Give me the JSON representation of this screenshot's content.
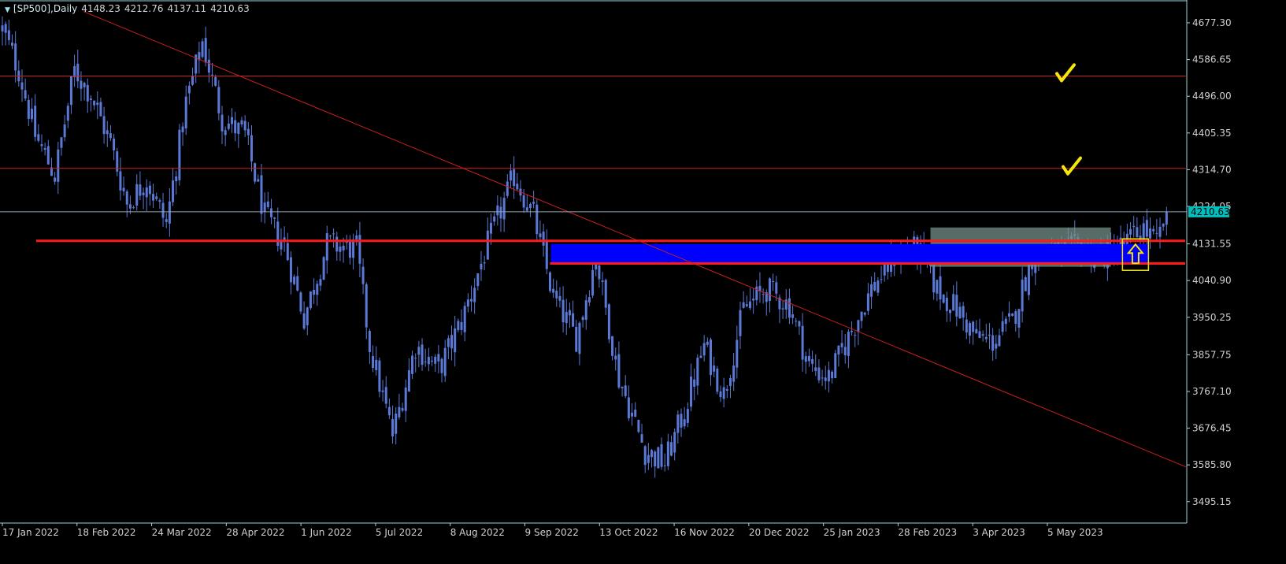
{
  "header": {
    "symbol": "[SP500],Daily",
    "open": "4148.23",
    "high": "4212.76",
    "low": "4137.11",
    "close": "4210.63"
  },
  "icons": {
    "header": "triangle-down-icon",
    "target": "checkmark-icon",
    "signal": "arrow-up-icon"
  },
  "colors": {
    "background": "#000000",
    "candle": "#5b79d6",
    "axis": "#9ed3dc",
    "price_line": "#8fa3b0",
    "level": "#cc1f1f",
    "trendline": "#cc1f1f",
    "zone": "#0000ff",
    "range_box": "#74908a",
    "marker": "#f5e50c",
    "price_tag_bg": "#00bfbf"
  },
  "chart_data": {
    "type": "candlestick",
    "timeframe": "Daily",
    "ylim": [
      3450,
      4720
    ],
    "y_ticks": [
      "4677.30",
      "4586.65",
      "4496.00",
      "4405.35",
      "4314.70",
      "4224.05",
      "4131.55",
      "4040.90",
      "3950.25",
      "3857.75",
      "3767.10",
      "3676.45",
      "3585.80",
      "3495.15"
    ],
    "x_ticks": [
      "17 Jan 2022",
      "18 Feb 2022",
      "24 Mar 2022",
      "28 Apr 2022",
      "1 Jun 2022",
      "5 Jul 2022",
      "8 Aug 2022",
      "9 Sep 2022",
      "13 Oct 2022",
      "16 Nov 2022",
      "20 Dec 2022",
      "25 Jan 2023",
      "28 Feb 2023",
      "3 Apr 2023",
      "5 May 2023"
    ],
    "bars_count": 360,
    "price_path": [
      {
        "bar": 0,
        "price": 4660
      },
      {
        "bar": 5,
        "price": 4560
      },
      {
        "bar": 10,
        "price": 4400
      },
      {
        "bar": 16,
        "price": 4300
      },
      {
        "bar": 22,
        "price": 4560
      },
      {
        "bar": 27,
        "price": 4500
      },
      {
        "bar": 33,
        "price": 4380
      },
      {
        "bar": 38,
        "price": 4230
      },
      {
        "bar": 44,
        "price": 4290
      },
      {
        "bar": 50,
        "price": 4180
      },
      {
        "bar": 56,
        "price": 4480
      },
      {
        "bar": 61,
        "price": 4630
      },
      {
        "bar": 67,
        "price": 4440
      },
      {
        "bar": 74,
        "price": 4400
      },
      {
        "bar": 80,
        "price": 4200
      },
      {
        "bar": 86,
        "price": 4130
      },
      {
        "bar": 92,
        "price": 3950
      },
      {
        "bar": 99,
        "price": 4130
      },
      {
        "bar": 108,
        "price": 4120
      },
      {
        "bar": 112,
        "price": 3880
      },
      {
        "bar": 119,
        "price": 3660
      },
      {
        "bar": 126,
        "price": 3880
      },
      {
        "bar": 133,
        "price": 3820
      },
      {
        "bar": 140,
        "price": 3940
      },
      {
        "bar": 148,
        "price": 4130
      },
      {
        "bar": 156,
        "price": 4300
      },
      {
        "bar": 162,
        "price": 4200
      },
      {
        "bar": 168,
        "price": 4000
      },
      {
        "bar": 175,
        "price": 3900
      },
      {
        "bar": 181,
        "price": 4100
      },
      {
        "bar": 188,
        "price": 3800
      },
      {
        "bar": 196,
        "price": 3620
      },
      {
        "bar": 202,
        "price": 3590
      },
      {
        "bar": 208,
        "price": 3720
      },
      {
        "bar": 214,
        "price": 3880
      },
      {
        "bar": 220,
        "price": 3760
      },
      {
        "bar": 226,
        "price": 3970
      },
      {
        "bar": 233,
        "price": 4020
      },
      {
        "bar": 240,
        "price": 3980
      },
      {
        "bar": 246,
        "price": 3830
      },
      {
        "bar": 252,
        "price": 3800
      },
      {
        "bar": 258,
        "price": 3900
      },
      {
        "bar": 265,
        "price": 4020
      },
      {
        "bar": 272,
        "price": 4100
      },
      {
        "bar": 279,
        "price": 4120
      },
      {
        "bar": 285,
        "price": 4020
      },
      {
        "bar": 291,
        "price": 3970
      },
      {
        "bar": 297,
        "price": 3900
      },
      {
        "bar": 302,
        "price": 3890
      },
      {
        "bar": 308,
        "price": 3940
      },
      {
        "bar": 314,
        "price": 4100
      },
      {
        "bar": 321,
        "price": 4110
      },
      {
        "bar": 328,
        "price": 4120
      },
      {
        "bar": 335,
        "price": 4100
      },
      {
        "bar": 342,
        "price": 4130
      },
      {
        "bar": 348,
        "price": 4170
      },
      {
        "bar": 352,
        "price": 4130
      },
      {
        "bar": 355,
        "price": 4210
      }
    ],
    "current_price": 4210.63,
    "horizontal_levels": [
      4546,
      4318
    ],
    "support_lines": [
      4139,
      4083
    ],
    "zone": {
      "from_bar": 167,
      "to_bar": 355,
      "low": 4090,
      "high": 4135
    },
    "range_box": {
      "from_bar": 283,
      "to_bar": 338,
      "low": 4075,
      "high": 4172
    },
    "trendline": [
      {
        "bar": 20,
        "price": 4705
      },
      {
        "bar": 355,
        "price": 3580
      }
    ],
    "targets": [
      4550,
      4320
    ],
    "signal_box": {
      "bar": 343,
      "low": 4070,
      "high": 4140
    }
  }
}
